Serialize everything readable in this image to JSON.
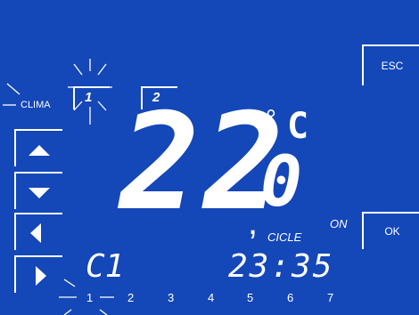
{
  "display": {
    "mode_label": "CLIMA",
    "zones": [
      "1",
      "2"
    ],
    "temperature_main": "22",
    "temperature_decimal": "0",
    "unit_degree": "°",
    "unit_c": "C",
    "program": "C1",
    "time": "23:35",
    "status_on": "ON",
    "cicle_label": "CICLE"
  },
  "buttons": {
    "esc": "ESC",
    "ok": "OK"
  },
  "days": [
    "1",
    "2",
    "3",
    "4",
    "5",
    "6",
    "7"
  ],
  "colors": {
    "background": "#1447b8",
    "foreground": "#ffffff"
  }
}
